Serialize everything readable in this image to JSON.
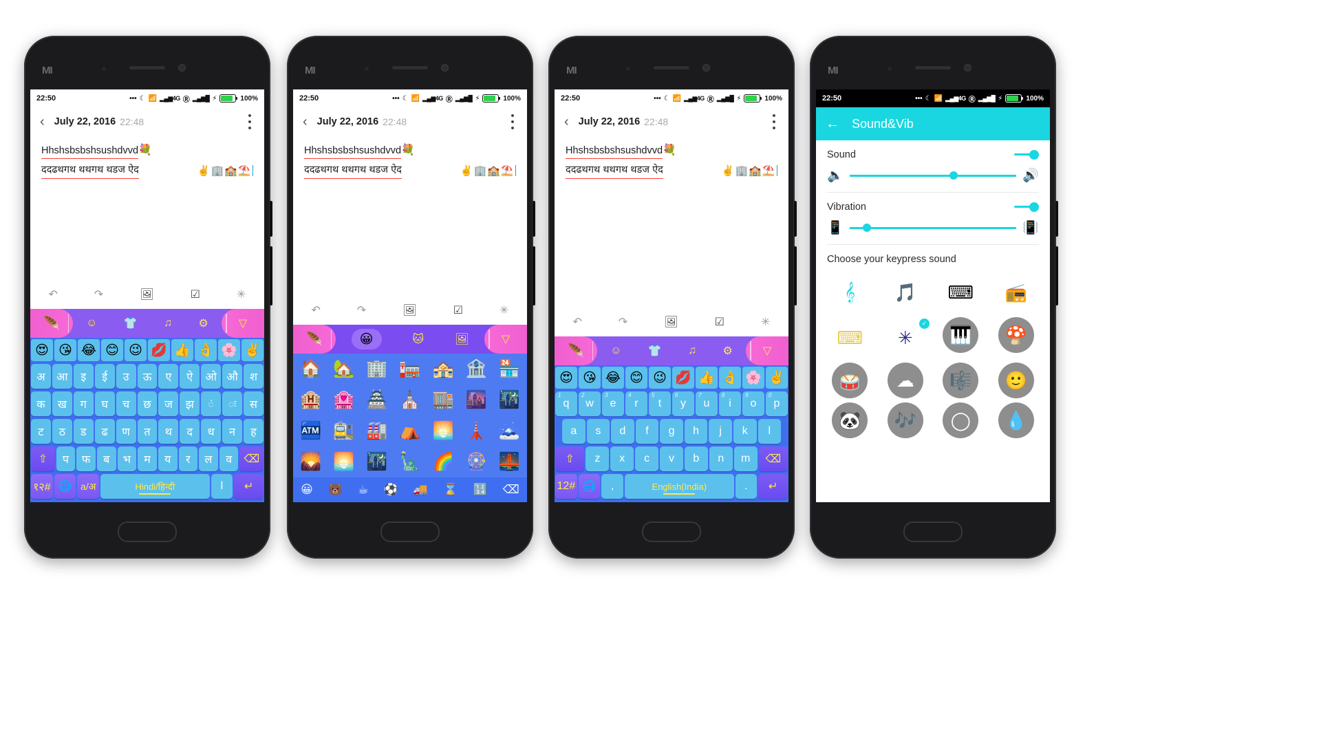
{
  "status_bar": {
    "time": "22:50",
    "battery_pct": "100%",
    "network": "4G 1X",
    "roam": "R"
  },
  "note": {
    "back_icon": "chevron-left-icon",
    "date": "July 22, 2016",
    "time": "22:48",
    "menu_icon": "overflow-menu-icon",
    "line1": "Hhshsbsbshsushdvvd",
    "line1_emoji": "💐",
    "line2": "ददढथगथ थथगथ थडज ऐद",
    "line2_emoji": "✌️🏢🏫⛱️",
    "toolbar": [
      {
        "name": "undo-icon",
        "glyph": "↶"
      },
      {
        "name": "redo-icon",
        "glyph": "↷"
      },
      {
        "name": "insert-image-icon",
        "glyph": "Ὓc"
      },
      {
        "name": "checklist-icon",
        "glyph": "☑"
      },
      {
        "name": "sparkle-icon",
        "glyph": "✳"
      }
    ]
  },
  "keyboard": {
    "top_tabs": [
      {
        "name": "theme-feather-tab",
        "glyph": "✎",
        "active": true
      },
      {
        "name": "emoji-tab",
        "glyph": "☺"
      },
      {
        "name": "sticker-tshirt-tab",
        "glyph": "👕"
      },
      {
        "name": "music-note-tab",
        "glyph": "♪"
      },
      {
        "name": "settings-gear-tab",
        "glyph": "⚙"
      },
      {
        "name": "collapse-keyboard-tab",
        "glyph": "▽"
      }
    ],
    "emoji_strip": [
      "😍",
      "😘",
      "😂",
      "😊",
      "😉",
      "💋",
      "👍",
      "👌",
      "🌸",
      "✌️"
    ],
    "hindi": {
      "row1": [
        "अ",
        "आ",
        "इ",
        "ई",
        "उ",
        "ऊ",
        "ए",
        "ऐ",
        "ओ",
        "औ",
        "श"
      ],
      "row2": [
        "क",
        "ख",
        "ग",
        "घ",
        "च",
        "छ",
        "ज",
        "झ",
        "ं",
        "ः",
        "स"
      ],
      "row3": [
        "ट",
        "ठ",
        "ड",
        "ढ",
        "ण",
        "त",
        "थ",
        "द",
        "ध",
        "न",
        "ह"
      ],
      "row4_shift": "⇧",
      "row4": [
        "प",
        "फ",
        "ब",
        "भ",
        "म",
        "य",
        "र",
        "ल",
        "व"
      ],
      "row4_del": "⌫",
      "num_key": "१२#",
      "globe_key": "🌐",
      "lang_key": "a/अ",
      "space_label": "Hindi/हिन्दी",
      "period_key": "l",
      "enter_key": "↵"
    },
    "english": {
      "row1": [
        "q",
        "w",
        "e",
        "r",
        "t",
        "y",
        "u",
        "i",
        "o",
        "p"
      ],
      "row1_nums": [
        "1",
        "2",
        "3",
        "4",
        "5",
        "6",
        "7",
        "8",
        "9",
        "0"
      ],
      "row2": [
        "a",
        "s",
        "d",
        "f",
        "g",
        "h",
        "j",
        "k",
        "l"
      ],
      "row3": [
        "z",
        "x",
        "c",
        "v",
        "b",
        "n",
        "m"
      ],
      "shift": "⇧",
      "del": "⌫",
      "num_key": "12#",
      "globe_key": "🌐",
      "comma_key": ",",
      "space_label": "English(India)",
      "period_key": ".",
      "enter_key": "↵"
    },
    "emoji_panel": {
      "rows": [
        [
          "🏠",
          "🏡",
          "🏢",
          "🏣",
          "🏤",
          "🏦",
          "🏪"
        ],
        [
          "🏨",
          "🏩",
          "🏯",
          "⛪",
          "🏬",
          "🌆",
          "🌃"
        ],
        [
          "🏧",
          "🚉",
          "🏭",
          "⛺",
          "🌅",
          "🗼",
          "🗻"
        ],
        [
          "🌄",
          "🌅",
          "🌃",
          "🗽",
          "🌈",
          "🎡",
          "🌉"
        ]
      ],
      "footer": [
        "😀",
        "🐻",
        "☕",
        "⚽",
        "🚚",
        "⌛",
        "🔢",
        "⌫"
      ]
    }
  },
  "settings": {
    "back_icon": "back-arrow-icon",
    "title": "Sound&Vib",
    "sound_label": "Sound",
    "sound_on": true,
    "sound_volume_pct": 60,
    "vibration_label": "Vibration",
    "vibration_on": true,
    "vibration_pct": 8,
    "keypress_section": "Choose your keypress sound",
    "sounds": [
      {
        "name": "treble-clef-sound",
        "glyph": "𝄞",
        "style": "plain",
        "selected": false
      },
      {
        "name": "music-note-sound",
        "glyph": "🎵",
        "style": "plain",
        "selected": false
      },
      {
        "name": "typewriter-sound",
        "glyph": "⌨",
        "style": "plain",
        "selected": false
      },
      {
        "name": "gramophone-sound",
        "glyph": "📻",
        "style": "plain",
        "selected": false
      },
      {
        "name": "keyboard-sound",
        "glyph": "⌨",
        "style": "plain",
        "selected": false
      },
      {
        "name": "sparkle-sound",
        "glyph": "✳",
        "style": "plain",
        "selected": true
      },
      {
        "name": "piano-sound",
        "glyph": "🎹",
        "style": "circle",
        "selected": false
      },
      {
        "name": "mushroom-sound",
        "glyph": "🍄",
        "style": "circle",
        "selected": false
      },
      {
        "name": "drum-sound",
        "glyph": "🪘",
        "style": "circle",
        "selected": false
      },
      {
        "name": "cloud-sound",
        "glyph": "☁",
        "style": "circle",
        "selected": false
      },
      {
        "name": "xylophone-sound",
        "glyph": "🥁",
        "style": "circle",
        "selected": false
      },
      {
        "name": "face-sound",
        "glyph": "🙂",
        "style": "circle",
        "selected": false
      },
      {
        "name": "panda-sound",
        "glyph": "🐼",
        "style": "circle",
        "selected": false
      },
      {
        "name": "notes-sound",
        "glyph": "🎶",
        "style": "circle",
        "selected": false
      },
      {
        "name": "bubble-sound",
        "glyph": "○",
        "style": "circle",
        "selected": false
      },
      {
        "name": "water-drop-sound",
        "glyph": "💧",
        "style": "circle",
        "selected": false
      }
    ]
  }
}
